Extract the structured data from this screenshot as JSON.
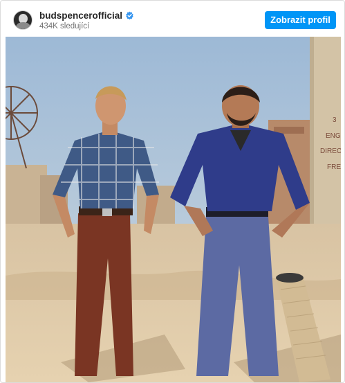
{
  "header": {
    "username": "budspencerofficial",
    "followers": "434K sledující",
    "profile_button_label": "Zobrazit profil",
    "avatar_icon": "person-avatar-icon",
    "verified_icon": "verified-badge-icon"
  },
  "post": {
    "sign_lines": [
      "3",
      "ENGR",
      "DIRECCI",
      "FREN"
    ]
  },
  "colors": {
    "accent": "#0095f6",
    "verified": "#3897f0",
    "sky": "#a8c2dc",
    "ground": "#d9c3a0"
  }
}
